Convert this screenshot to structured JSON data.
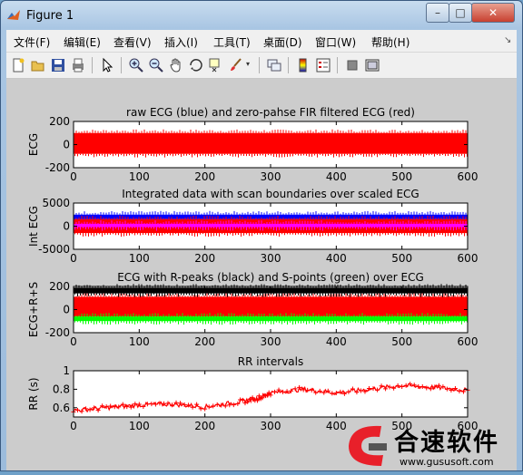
{
  "window": {
    "title": "Figure 1",
    "min": "–",
    "max": "□",
    "close": "✕"
  },
  "menu": [
    "文件(F)",
    "编辑(E)",
    "查看(V)",
    "插入(I)",
    "工具(T)",
    "桌面(D)",
    "窗口(W)",
    "帮助(H)"
  ],
  "menu_arrow": "↘",
  "toolbar": {
    "icons": [
      "new-figure-icon",
      "open-file-icon",
      "save-icon",
      "print-icon",
      "pointer-icon",
      "zoom-in-icon",
      "zoom-out-icon",
      "pan-icon",
      "rotate-3d-icon",
      "data-cursor-icon",
      "brush-icon",
      "link-icon",
      "colorbar-icon",
      "legend-icon",
      "hide-plot-tools-icon",
      "show-plot-tools-icon"
    ]
  },
  "colors": {
    "blue": "#0000ff",
    "red": "#ff0000",
    "magenta": "#ff00ff",
    "black": "#000000",
    "green": "#00ff00"
  },
  "chart_data": [
    {
      "type": "line",
      "title": "raw ECG (blue) and zero-pahse FIR filtered ECG (red)",
      "ylabel": "ECG",
      "xlim": [
        0,
        600
      ],
      "ylim": [
        -200,
        200
      ],
      "xticks": [
        "0",
        "100",
        "200",
        "300",
        "400",
        "500",
        "600"
      ],
      "yticks": [
        "200",
        "0",
        "-200"
      ],
      "series": [
        {
          "color": "#ff0000",
          "band": [
            -80,
            100
          ]
        }
      ]
    },
    {
      "type": "line",
      "title": "Integrated data with scan boundaries over scaled ECG",
      "ylabel": "Int ECG",
      "xlim": [
        0,
        600
      ],
      "ylim": [
        -5000,
        5000
      ],
      "xticks": [
        "0",
        "100",
        "200",
        "300",
        "400",
        "500",
        "600"
      ],
      "yticks": [
        "5000",
        "0",
        "-5000"
      ],
      "series": [
        {
          "color": "#0000ff",
          "band": [
            1500,
            2500
          ]
        },
        {
          "color": "#ff0000",
          "band": [
            -1500,
            1500
          ]
        },
        {
          "color": "#ff00ff",
          "band": [
            -200,
            500
          ]
        }
      ]
    },
    {
      "type": "line",
      "title": "ECG with R-peaks (black) and S-points (green) over ECG",
      "ylabel": "ECG+R+S",
      "xlim": [
        0,
        600
      ],
      "ylim": [
        -200,
        200
      ],
      "xticks": [
        "0",
        "100",
        "200",
        "300",
        "400",
        "500",
        "600"
      ],
      "yticks": [
        "200",
        "0",
        "-200"
      ],
      "series": [
        {
          "color": "#ff0000",
          "band": [
            -60,
            110
          ]
        },
        {
          "color": "#000000",
          "band": [
            140,
            190
          ]
        },
        {
          "color": "#00ff00",
          "band": [
            -100,
            -60
          ]
        }
      ]
    },
    {
      "type": "line",
      "title": "RR intervals",
      "ylabel": "RR (s)",
      "xlim": [
        0,
        600
      ],
      "ylim": [
        0.5,
        1.0
      ],
      "xticks": [
        "0",
        "100",
        "200",
        "300",
        "400",
        "500",
        "600"
      ],
      "yticks": [
        "1",
        "0.8",
        "0.6"
      ],
      "series": [
        {
          "color": "#ff0000",
          "x": [
            0,
            50,
            100,
            150,
            200,
            250,
            280,
            300,
            350,
            400,
            450,
            500,
            550,
            600
          ],
          "y": [
            0.57,
            0.6,
            0.63,
            0.64,
            0.61,
            0.66,
            0.7,
            0.76,
            0.8,
            0.76,
            0.8,
            0.84,
            0.82,
            0.79
          ]
        }
      ]
    }
  ],
  "watermark": {
    "cn": "合速软件",
    "url": "www.gususoft.com"
  }
}
